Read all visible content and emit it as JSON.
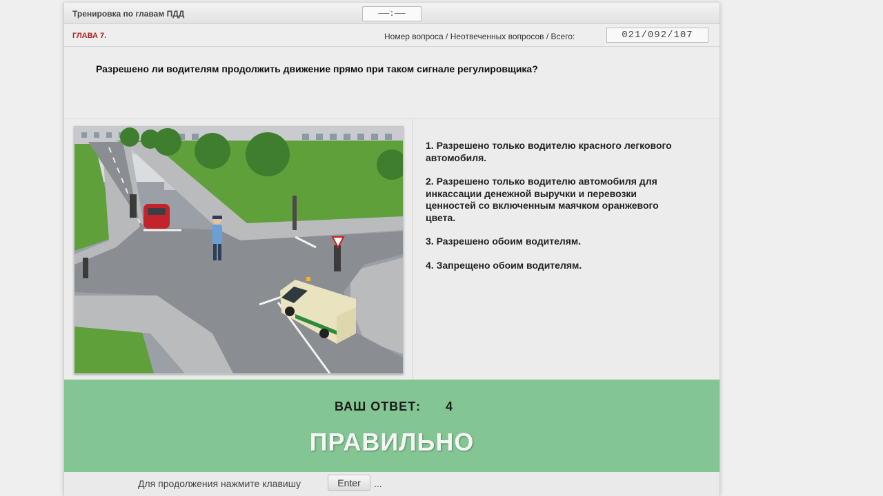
{
  "header": {
    "title": "Тренировка по главам ПДД",
    "timer": "——:——"
  },
  "infobar": {
    "chapter": "ГЛАВА 7.",
    "counter_label": "Номер вопроса / Неотвеченных вопросов / Всего:",
    "counter_value": "021/092/107"
  },
  "question": {
    "text": "Разрешено ли водителям продолжить движение прямо при таком сигнале регулировщика?"
  },
  "answers": [
    {
      "label": "1.  Разрешено только водителю красного легкового\nавтомобиля."
    },
    {
      "label": "2.  Разрешено только водителю автомобиля для\nинкассации денежной выручки и перевозки\nценностей со включенным маячком оранжевого\nцвета."
    },
    {
      "label": "3.  Разрешено обоим водителям."
    },
    {
      "label": "4.  Запрещено обоим водителям."
    }
  ],
  "result": {
    "your_answer_label": "ВАШ  ОТВЕТ:",
    "your_answer_value": "4",
    "verdict": "ПРАВИЛЬНО",
    "color": "#84c594"
  },
  "footer": {
    "continue_text": "Для продолжения нажмите клавишу",
    "key_label": "Enter",
    "ellipsis": "..."
  }
}
